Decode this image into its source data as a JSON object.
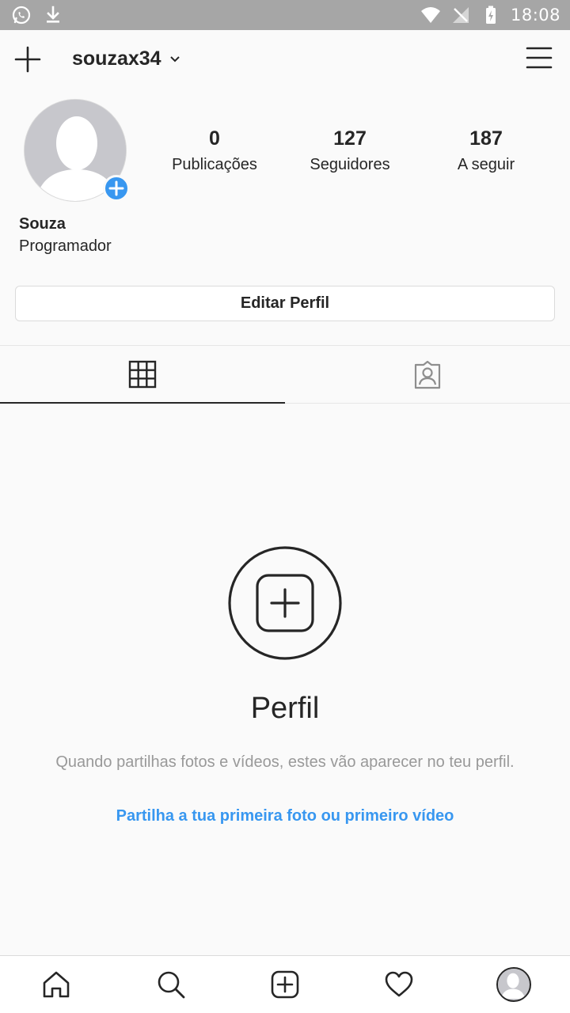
{
  "status_bar": {
    "time": "18:08",
    "left_icons": [
      "whatsapp-icon",
      "download-icon"
    ],
    "right_icons": [
      "wifi-icon",
      "no-signal-icon",
      "battery-charging-icon"
    ]
  },
  "header": {
    "username": "souzax34",
    "left_icon": "plus-icon",
    "right_icon": "menu-icon"
  },
  "profile": {
    "name": "Souza",
    "bio": "Programador",
    "stats": [
      {
        "value": "0",
        "label": "Publicações"
      },
      {
        "value": "127",
        "label": "Seguidores"
      },
      {
        "value": "187",
        "label": "A seguir"
      }
    ],
    "edit_button_label": "Editar Perfil"
  },
  "tabs": [
    {
      "icon": "grid-icon",
      "active": true
    },
    {
      "icon": "tagged-icon",
      "active": false
    }
  ],
  "empty_state": {
    "title": "Perfil",
    "description": "Quando partilhas fotos e vídeos, estes vão aparecer no teu perfil.",
    "link": "Partilha a tua primeira foto ou primeiro vídeo"
  },
  "bottom_nav": [
    "home-icon",
    "search-icon",
    "new-post-icon",
    "heart-icon",
    "profile-avatar"
  ],
  "colors": {
    "accent": "#3897f0",
    "status_bar": "#a6a6a6",
    "text": "#262626",
    "muted": "#999999"
  }
}
